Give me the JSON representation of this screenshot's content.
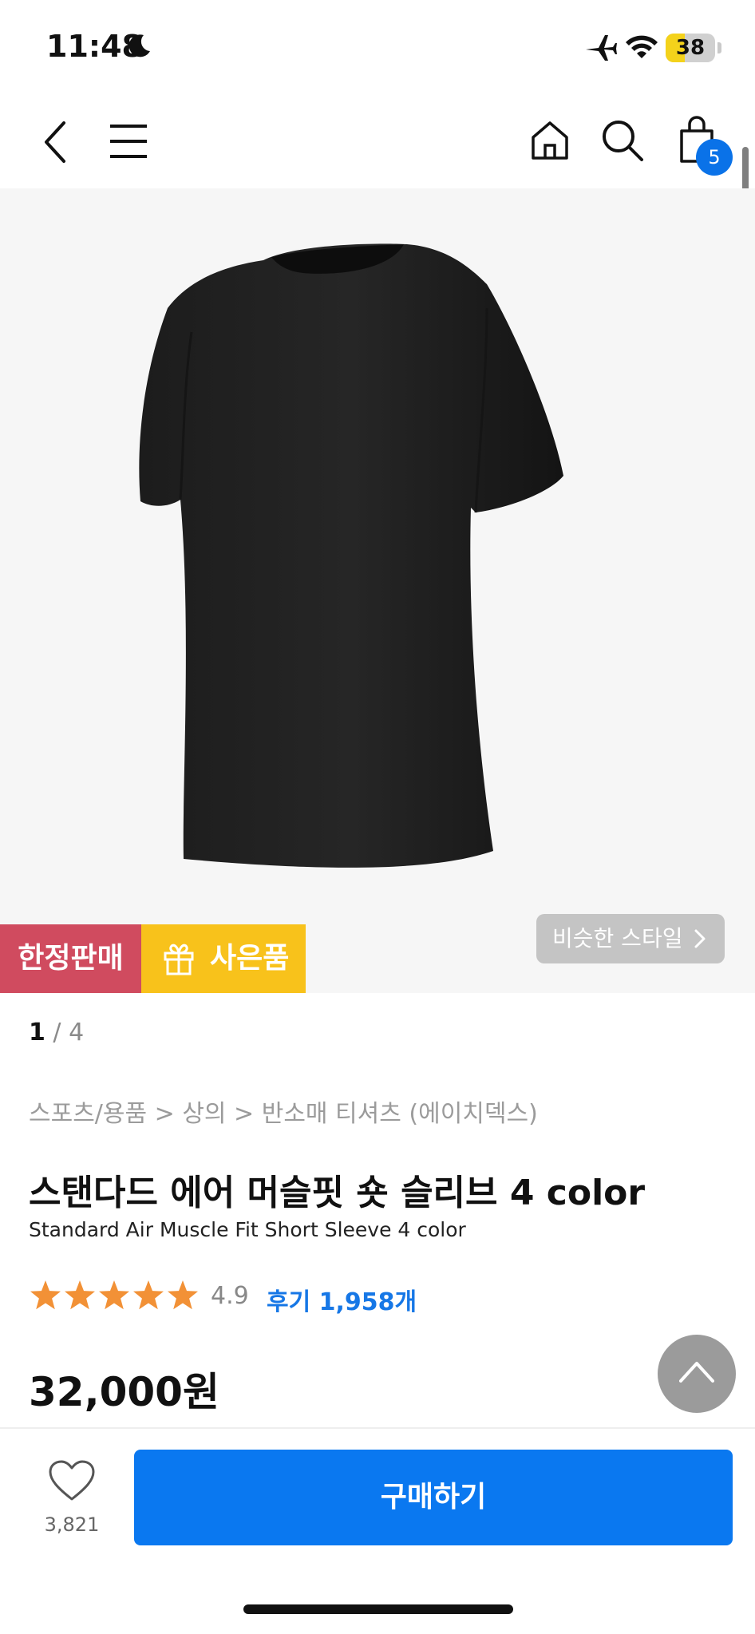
{
  "status_bar": {
    "time": "11:48",
    "battery_level": 38,
    "battery_text": "38"
  },
  "nav": {
    "cart_count": "5"
  },
  "product": {
    "badges": {
      "limited": "한정판매",
      "gift": "사은품"
    },
    "similar_style": "비슷한 스타일",
    "image_pager": {
      "current": "1",
      "total": "/ 4"
    },
    "breadcrumb": "스포츠/용품 > 상의 > 반소매 티셔츠 (에이치덱스)",
    "title_ko": "스탠다드 에어 머슬핏 숏 슬리브 4 color",
    "title_en": "Standard Air Muscle Fit Short Sleeve 4 color",
    "rating": {
      "stars": 5,
      "value": "4.9",
      "reviews": "후기 1,958개"
    },
    "price": "32,000원"
  },
  "bottom_bar": {
    "wishlist_count": "3,821",
    "buy_label": "구매하기"
  },
  "colors": {
    "accent_blue": "#0a78f0",
    "limited_tag": "#d04b5f",
    "gift_tag": "#f8c21b",
    "star": "#f29136"
  }
}
